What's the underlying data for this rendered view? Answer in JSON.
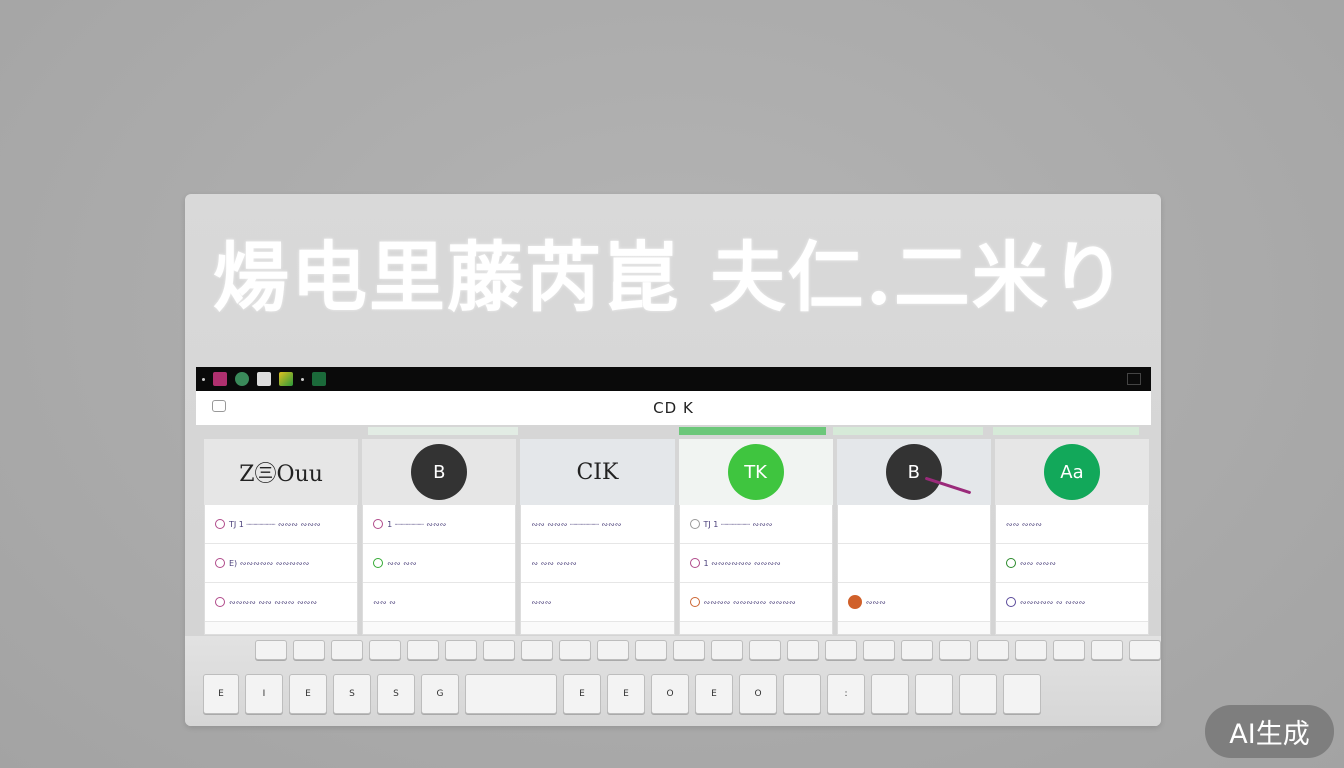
{
  "headline": "煬电里藤芮崑 夫仁.二米り",
  "address": {
    "text": "CD K"
  },
  "columns": [
    {
      "head": "Ζ㊂Ouu",
      "style": "text",
      "rows": [
        "TJ 1 ┈┈┈┈┈┈ ∾∾∾ ∾∾∾",
        "E) ∾∾∾∾∾ ∾∾∾∾∾",
        "∾∾∾∾ ∾∾ ∾∾∾ ∾∾∾"
      ]
    },
    {
      "head": "B",
      "style": "circle-dark",
      "rows": [
        "1 ┈┈┈┈┈┈ ∾∾∾",
        "∾∾ ∾∾",
        "∾∾ ∾"
      ]
    },
    {
      "head": "CIK",
      "style": "text",
      "rows": [
        "∾∾ ∾∾∾ ┈┈┈┈┈┈ ∾∾∾",
        "∾ ∾∾ ∾∾∾",
        "∾∾∾"
      ]
    },
    {
      "head": "TK",
      "style": "circle-green",
      "rows": [
        "TJ 1 ┈┈┈┈┈┈ ∾∾∾",
        "1 ∾∾∾∾∾∾ ∾∾∾∾",
        "∾∾∾∾ ∾∾∾∾∾ ∾∾∾∾"
      ]
    },
    {
      "head": "B",
      "style": "circle-dark-pen",
      "rows": [
        "",
        "",
        "∾∾∾"
      ]
    },
    {
      "head": "Aa",
      "style": "circle-emerald",
      "rows": [
        "∾∾ ∾∾∾",
        "∾∾ ∾∾∾",
        "∾∾∾∾∾ ∾ ∾∾∾"
      ]
    }
  ],
  "keys_row2": [
    "E",
    "I",
    "E",
    "S",
    "S",
    "G",
    "",
    "E",
    "E",
    "O",
    "E",
    "O",
    "",
    ":",
    "",
    "",
    "",
    ""
  ],
  "watermark": "AI生成",
  "colors": {
    "green": "#3fc53f",
    "emerald": "#12a85a",
    "dark": "#333333",
    "taskbar": "#0a0a0a"
  }
}
